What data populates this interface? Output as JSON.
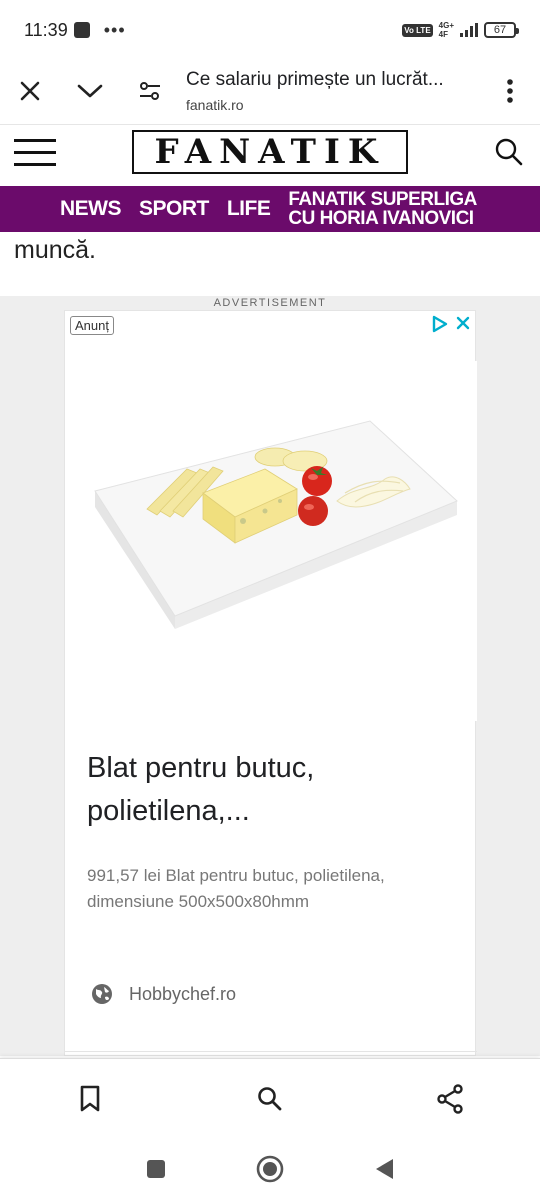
{
  "status_bar": {
    "time": "11:39",
    "dots": "•••",
    "volte": "Vo LTE",
    "network_top": "4G+",
    "network_bottom": "4F",
    "battery": "67"
  },
  "browser": {
    "title": "Ce salariu primește un lucrăt...",
    "url": "fanatik.ro"
  },
  "site": {
    "logo": "FANATIK"
  },
  "nav": {
    "items": [
      {
        "label": "NEWS"
      },
      {
        "label": "SPORT"
      },
      {
        "label": "LIFE"
      }
    ],
    "superliga_line1": "FANATIK SUPERLIGA",
    "superliga_line2": "CU HORIA IVANOVICI",
    "color": "#6b0b6b"
  },
  "article": {
    "tail_text": "muncă."
  },
  "ad": {
    "label": "ADVERTISEMENT",
    "badge": "Anunț",
    "title": "Blat pentru butuc, polietilena,...",
    "description": "991,57 lei Blat pentru butuc, polietilena, dimensiune 500x500x80hmm",
    "source": "Hobbychef.ro",
    "choices_color": "#00aecd"
  },
  "icons": {
    "close": "close-icon",
    "chevron": "chevron-down-icon",
    "site_settings": "tune-icon",
    "menu": "more-vert-icon",
    "hamburger": "hamburger-icon",
    "search": "search-icon",
    "bookmark": "bookmark-icon",
    "share": "share-icon",
    "globe": "globe-icon"
  }
}
